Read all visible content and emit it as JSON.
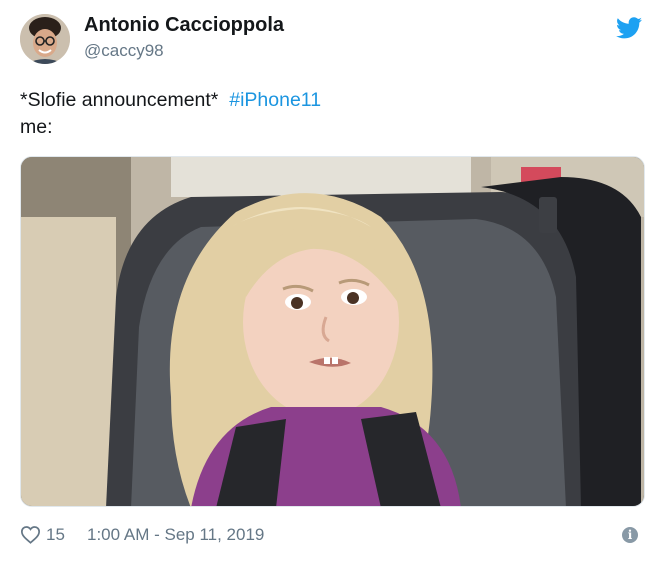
{
  "author": {
    "name": "Antonio Caccioppola",
    "handle": "@caccy98"
  },
  "tweet": {
    "text_part": "*Slofie announcement*",
    "hashtag": "#iPhone11",
    "line2": "me:"
  },
  "media": {
    "icon": "photo-meme-icon"
  },
  "footer": {
    "likes": "15",
    "timestamp": "1:00 AM - Sep 11, 2019"
  },
  "icons": {
    "brand": "twitter-bird-icon",
    "like": "heart-icon",
    "info": "info-icon"
  },
  "colors": {
    "brand": "#1da1f2",
    "hashtag": "#1b95e0",
    "secondary_text": "#657786"
  }
}
